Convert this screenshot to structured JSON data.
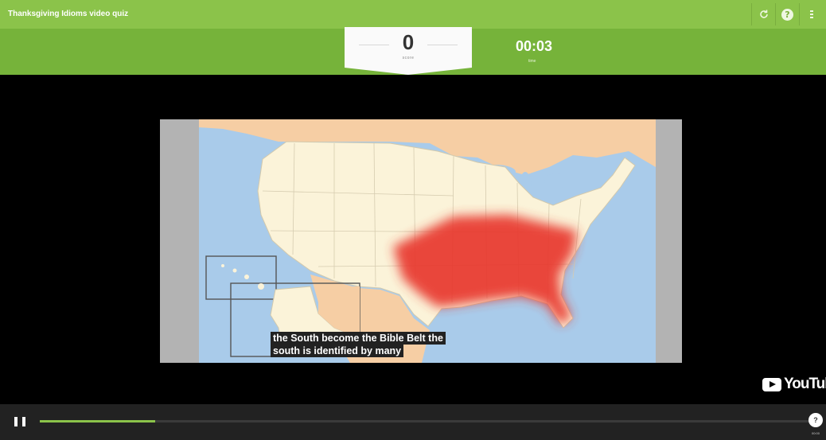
{
  "header": {
    "title": "Thanksgiving Idioms video quiz",
    "icons": [
      "refresh-icon",
      "help-icon",
      "menu-icon"
    ],
    "help_glyph": "?"
  },
  "status": {
    "score": "0",
    "score_label": "score",
    "timer": "00:03",
    "timer_label": "time"
  },
  "video": {
    "subtitle_line1": "the South become the Bible Belt the",
    "subtitle_line2": "south is identified by many",
    "watermark": "YouTube"
  },
  "player": {
    "progress": 0.15,
    "end_marker": "?",
    "end_time": "00:00"
  },
  "colors": {
    "accent": "#8bc34a",
    "status_band": "#76b33a",
    "highlight_region": "#e8392f"
  }
}
